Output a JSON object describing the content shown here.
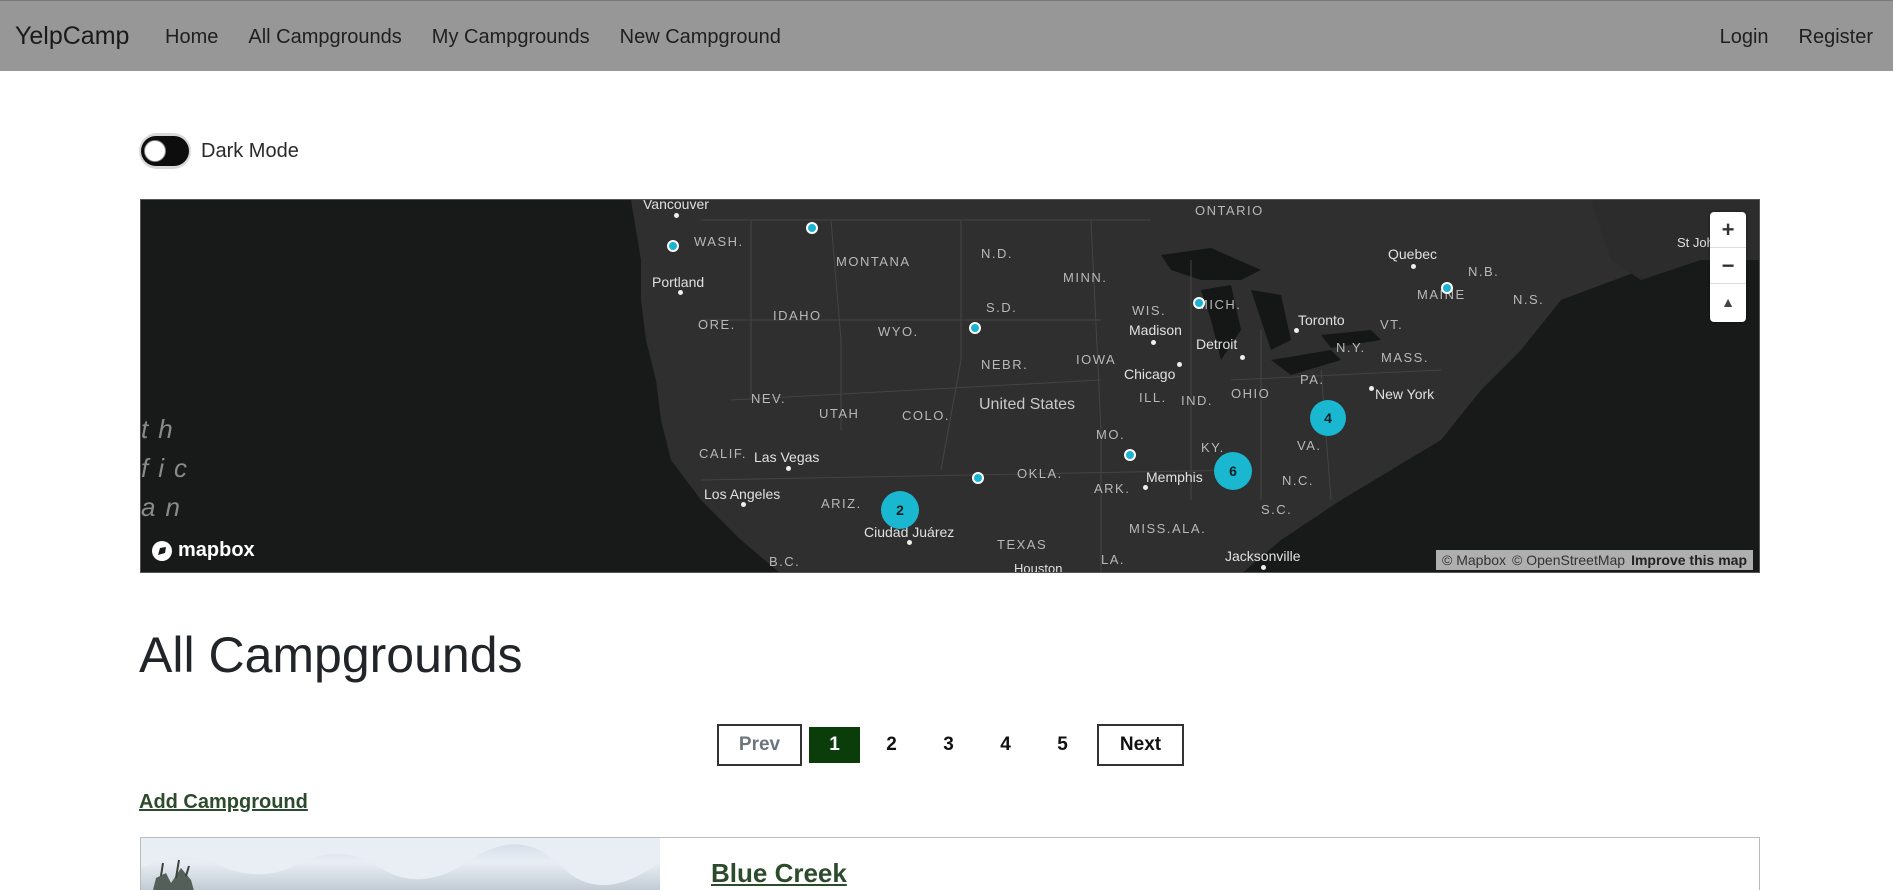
{
  "navbar": {
    "brand": "YelpCamp",
    "links": [
      "Home",
      "All Campgrounds",
      "My Campgrounds",
      "New Campground"
    ],
    "right_links": [
      "Login",
      "Register"
    ]
  },
  "dark_mode": {
    "label": "Dark Mode",
    "enabled": false
  },
  "map": {
    "labels": {
      "vancouver": "Vancouver",
      "wash": "WASH.",
      "montana": "MONTANA",
      "nd": "N.D.",
      "ontario": "ONTARIO",
      "quebec": "Quebec",
      "stjohn": "St Joh",
      "nb": "N.B.",
      "ns": "N.S.",
      "maine": "MAINE",
      "vt": "VT.",
      "portland": "Portland",
      "idaho": "IDAHO",
      "sd": "S.D.",
      "minn": "MINN.",
      "wis": "WIS.",
      "mich": "MICH.",
      "toronto": "Toronto",
      "ore": "ORE.",
      "wyo": "WYO.",
      "madison": "Madison",
      "detroit": "Detroit",
      "ny": "N.Y.",
      "mass": "MASS.",
      "nebr": "NEBR.",
      "iowa": "IOWA",
      "chicago": "Chicago",
      "pa": "PA.",
      "nev": "NEV.",
      "utah": "UTAH",
      "colo": "COLO.",
      "us": "United States",
      "ill": "ILL.",
      "ind": "IND.",
      "ohio": "OHIO",
      "newyork": "New York",
      "mo": "MO.",
      "ky": "KY.",
      "va": "VA.",
      "calif": "CALIF.",
      "lasvegas": "Las Vegas",
      "okla": "OKLA.",
      "ark": "ARK.",
      "memphis": "Memphis",
      "nc": "N.C.",
      "la_city": "Los Angeles",
      "ariz": "ARIZ.",
      "ciudad": "Ciudad Juárez",
      "texas": "TEXAS",
      "miss": "MISS.",
      "ala": "ALA.",
      "sc": "S.C.",
      "jacksonville": "Jacksonville",
      "bc": "B.C.",
      "houston": "Houston",
      "la": "LA.",
      "ocean1": "th",
      "ocean2": "fic",
      "ocean3": "an"
    },
    "clusters": [
      {
        "count": "2"
      },
      {
        "count": "6"
      },
      {
        "count": "4"
      }
    ],
    "controls": {
      "zoom_in": "+",
      "zoom_out": "−",
      "compass": "▲"
    },
    "logo": "mapbox",
    "attribution": {
      "mapbox": "© Mapbox",
      "osm": "© OpenStreetMap",
      "improve": "Improve this map"
    }
  },
  "main": {
    "title": "All Campgrounds",
    "pagination": {
      "prev": "Prev",
      "pages": [
        "1",
        "2",
        "3",
        "4",
        "5"
      ],
      "current": "1",
      "next": "Next"
    },
    "add_link": "Add Campground"
  },
  "campgrounds": [
    {
      "title": "Blue Creek"
    }
  ]
}
